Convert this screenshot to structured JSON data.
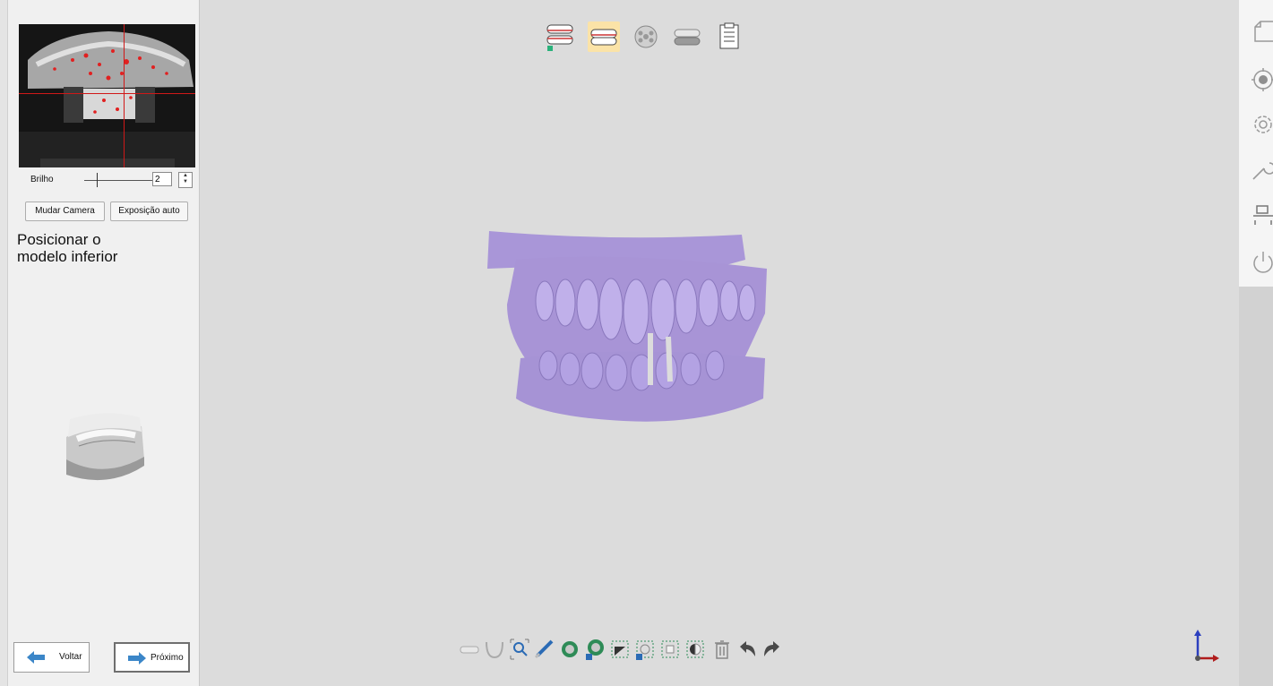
{
  "camera": {
    "brightness_label": "Brilho",
    "brightness_value": "2",
    "brightness_level": 0.15,
    "change_camera_label": "Mudar Camera",
    "auto_exposure_label": "Exposição auto"
  },
  "instruction": {
    "line1": "Posicionar o",
    "line2": "modelo inferior"
  },
  "navigation": {
    "back_label": "Voltar",
    "next_label": "Próximo"
  },
  "top_toolbar": {
    "steps": [
      "upper-lower-jaw-icon",
      "occlusion-icon",
      "die-scan-icon",
      "lower-jaw-icon",
      "report-icon"
    ],
    "active_step": 1
  },
  "colors": {
    "accent": "#fbe3a7",
    "arrow_blue": "#3b86c8",
    "model_purple": "#a894d6",
    "crosshair_red": "#d01818"
  },
  "right_sidebar": {
    "items": [
      "new-file-icon",
      "scan-target-icon",
      "settings-gear-icon",
      "tools-wrench-icon",
      "layout-icon",
      "power-icon"
    ]
  },
  "bottom_toolbar": {
    "items": [
      "upper-jaw-view-icon",
      "arch-curve-icon",
      "zoom-fit-icon",
      "brush-select-icon",
      "select-region-icon",
      "deselect-region-icon",
      "lasso-select-icon",
      "lasso-deselect-icon",
      "box-select-icon",
      "invert-select-icon",
      "delete-icon",
      "undo-icon",
      "redo-icon"
    ]
  }
}
